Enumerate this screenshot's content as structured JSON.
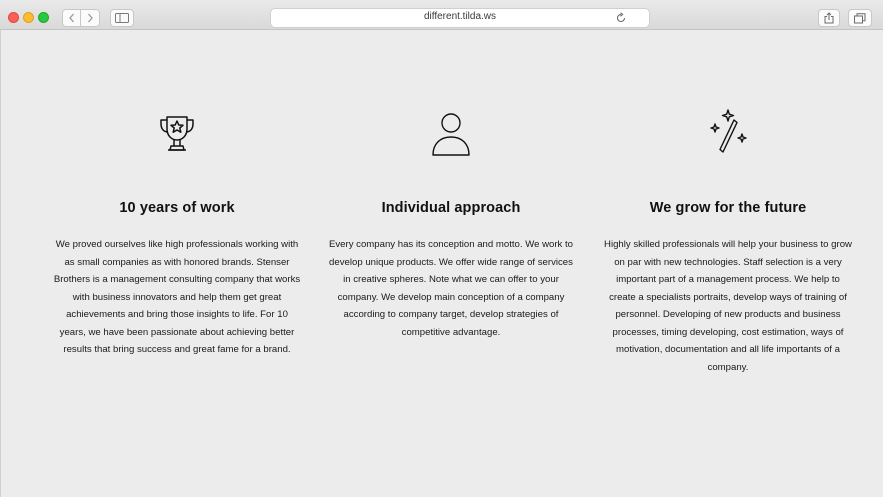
{
  "browser": {
    "url": "different.tilda.ws"
  },
  "features": [
    {
      "icon": "trophy-icon",
      "title": "10 years of work",
      "text": "We proved ourselves like high professionals working with as small companies as with honored brands. Stenser Brothers is a management consulting company that works with business innovators and help them get great achievements and bring those insights to life. For 10 years, we have been passionate about achieving better results that bring success and great fame for a brand."
    },
    {
      "icon": "person-icon",
      "title": "Individual approach",
      "text": "Every company has its conception and motto. We work to develop unique products. We offer wide range of services in creative spheres. Note what we can offer to your company. We develop main conception of a company according to company target, develop strategies of competitive advantage."
    },
    {
      "icon": "magic-wand-icon",
      "title": "We grow for the future",
      "text": "Highly skilled professionals will help your business to grow on par with new technologies. Staff selection is a very important part of a management process. We help to create a specialists portraits, develop ways of training of personnel. Developing of new products and business processes, timing developing, cost estimation, ways of motivation, documentation and all life importants of a company."
    }
  ]
}
